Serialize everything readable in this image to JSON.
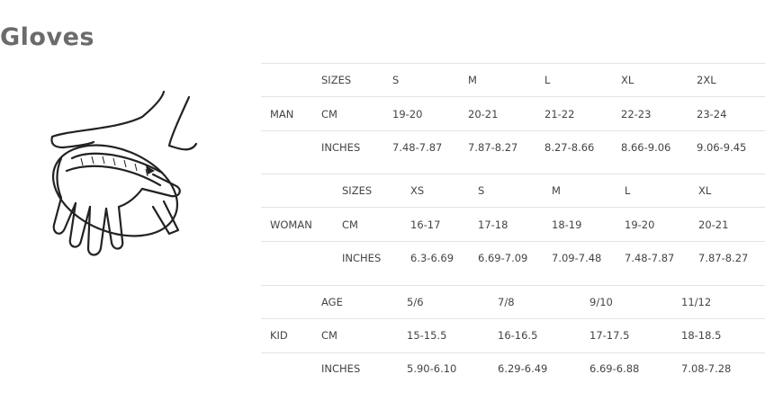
{
  "page": {
    "title": "Gloves"
  },
  "man": {
    "label": "MAN",
    "rows": [
      {
        "label": "SIZES",
        "values": [
          "S",
          "M",
          "L",
          "XL",
          "2XL"
        ]
      },
      {
        "label": "CM",
        "values": [
          "19-20",
          "20-21",
          "21-22",
          "22-23",
          "23-24"
        ]
      },
      {
        "label": "INCHES",
        "values": [
          "7.48-7.87",
          "7.87-8.27",
          "8.27-8.66",
          "8.66-9.06",
          "9.06-9.45"
        ]
      }
    ]
  },
  "woman": {
    "label": "WOMAN",
    "rows": [
      {
        "label": "SIZES",
        "values": [
          "XS",
          "S",
          "M",
          "L",
          "XL"
        ]
      },
      {
        "label": "CM",
        "values": [
          "16-17",
          "17-18",
          "18-19",
          "19-20",
          "20-21"
        ]
      },
      {
        "label": "INCHES",
        "values": [
          "6.3-6.69",
          "6.69-7.09",
          "7.09-7.48",
          "7.48-7.87",
          "7.87-8.27"
        ]
      }
    ]
  },
  "kid": {
    "label": "KID",
    "rows": [
      {
        "label": "AGE",
        "values": [
          "5/6",
          "7/8",
          "9/10",
          "11/12"
        ]
      },
      {
        "label": "CM",
        "values": [
          "15-15.5",
          "16-16.5",
          "17-17.5",
          "18-18.5"
        ]
      },
      {
        "label": "INCHES",
        "values": [
          "5.90-6.10",
          "6.29-6.49",
          "6.69-6.88",
          "7.08-7.28"
        ]
      }
    ]
  }
}
